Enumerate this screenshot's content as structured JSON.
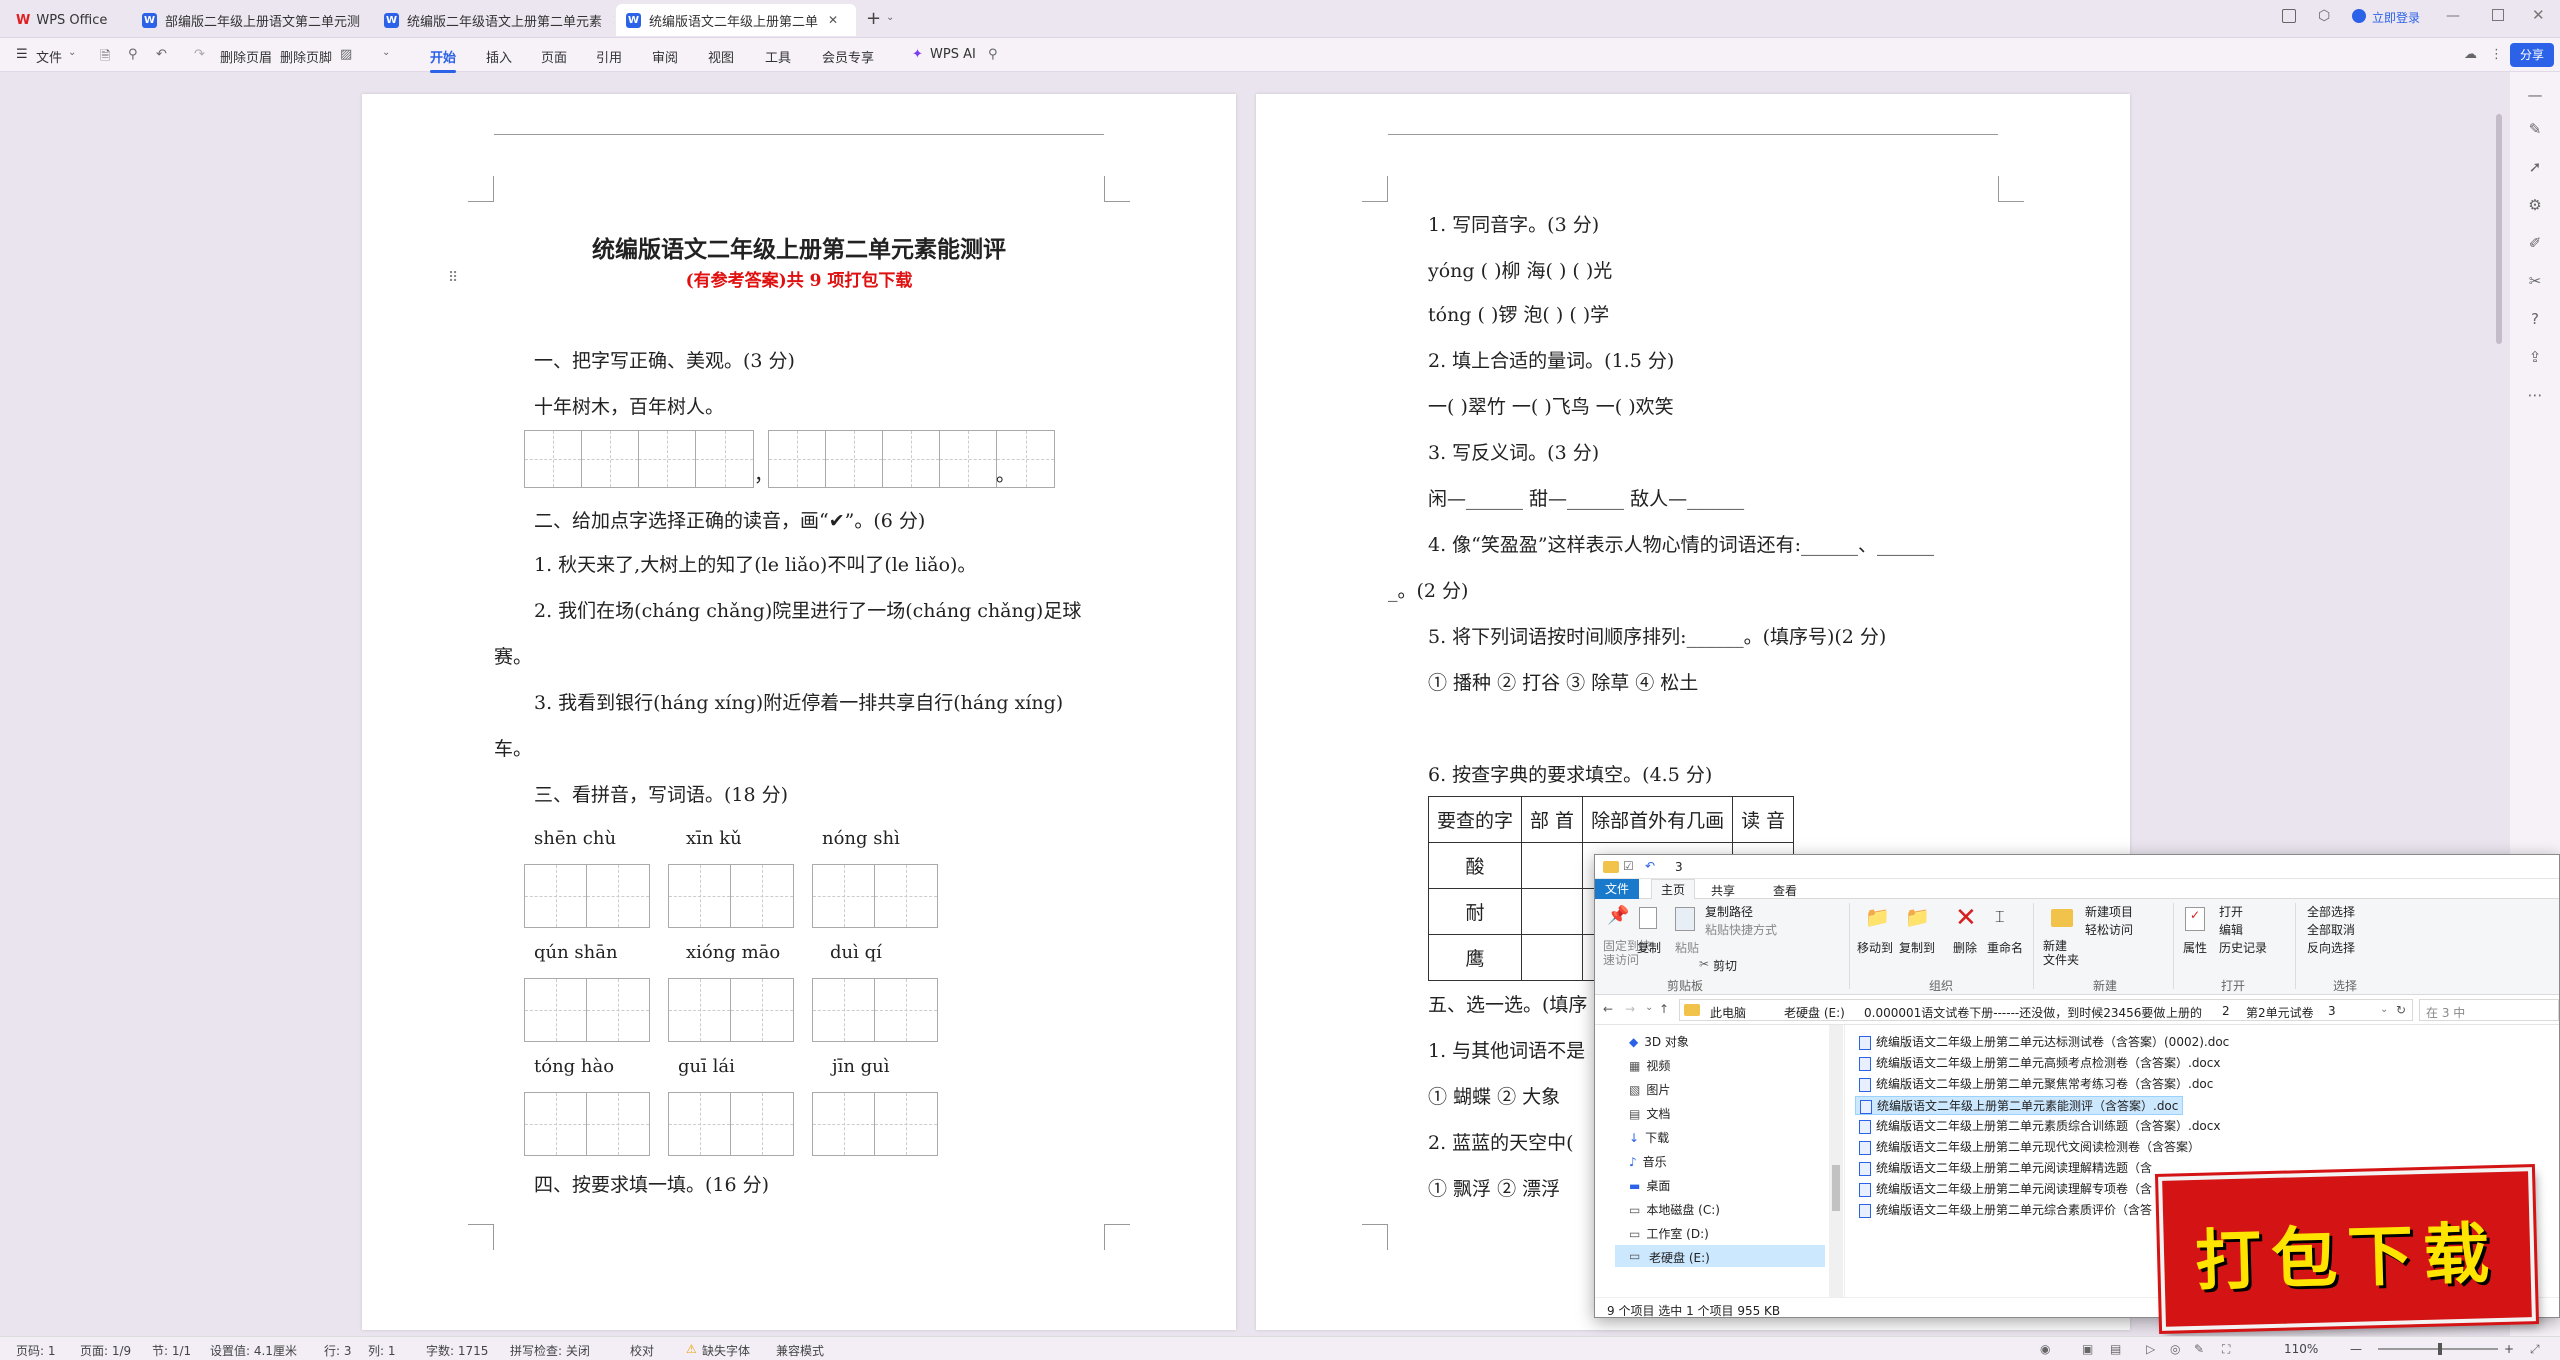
{
  "tabs": [
    {
      "label": "WPS Office"
    },
    {
      "label": "部编版二年级上册语文第二单元测"
    },
    {
      "label": "统编版二年级语文上册第二单元素"
    },
    {
      "label": "统编版语文二年级上册第二单"
    }
  ],
  "topbar": {
    "login": "立即登录",
    "plus": "+"
  },
  "toolbar": {
    "file": "文件",
    "delete_header": "删除页眉",
    "delete_footer": "删除页脚",
    "tabs": [
      "开始",
      "插入",
      "页面",
      "引用",
      "审阅",
      "视图",
      "工具",
      "会员专享"
    ],
    "wps_ai": "WPS AI",
    "share": "分享"
  },
  "page1": {
    "title": "统编版语文二年级上册第二单元素能测评",
    "subtitle": "(有参考答案)共 9 项打包下载",
    "q1": "一、把字写正确、美观。(3 分)",
    "q1_text": "十年树木，百年树人。",
    "comma": "，",
    "period": "。",
    "q2": "二、给加点字选择正确的读音，画“✔”。(6 分)",
    "q2_1": "1. 秋天来了,大树上的知了(le liǎo)不叫了(le  liǎo)。",
    "q2_2a": "2. 我们在场(cháng chǎng)院里进行了一场(cháng chǎng)足球",
    "q2_2b": "赛。",
    "q2_3a": "3. 我看到银行(háng xíng)附近停着一排共享自行(háng xíng)",
    "q2_3b": "车。",
    "q3": "三、看拼音，写词语。(18 分)",
    "pinyin": [
      [
        "shēn chù",
        "xīn  kǔ",
        "nóng  shì"
      ],
      [
        "qún shān",
        "xióng māo",
        "duì  qí"
      ],
      [
        "tóng  hào",
        "guī  lái",
        "jīn  guì"
      ]
    ],
    "q4": "四、按要求填一填。(16 分)"
  },
  "page2": {
    "p1": "1. 写同音字。(3 分)",
    "p1a": "yóng (       )柳   海(        )  (        )光",
    "p1b": "tóng (       )锣   泡(        )  (        )学",
    "p2": "2. 填上合适的量词。(1.5 分)",
    "p2a": "一(        )翠竹  一(        )飞鸟  一(        )欢笑",
    "p3": "3. 写反义词。(3 分)",
    "p3a": "闲—______   甜—______   敌人—______",
    "p4": "4. 像“笑盈盈”这样表示人物心情的词语还有:______、______",
    "p4b": "_。(2 分)",
    "p5": "5. 将下列词语按时间顺序排列:______。(填序号)(2 分)",
    "p5a": "① 播种 ② 打谷  ③ 除草 ④ 松土",
    "p6": "6. 按查字典的要求填空。(4.5 分)",
    "table_head": [
      "要查的字",
      "部 首",
      "除部首外有几画",
      "读 音"
    ],
    "table_rows": [
      "酸",
      "耐",
      "鹰"
    ],
    "s5": "五、选一选。(填序",
    "s5_1": "1. 与其他词语不是",
    "s5_1a": "① 蝴蝶  ② 大象",
    "s5_2": "2. 蓝蓝的天空中(",
    "s5_2a": "① 飘浮  ② 漂浮"
  },
  "explorer": {
    "title": "3",
    "menu": [
      "文件",
      "主页",
      "共享",
      "查看"
    ],
    "ribbon": {
      "pin": "固定到快\n速访问",
      "copy": "复制",
      "paste": "粘贴",
      "copy_path": "复制路径",
      "paste_shortcut": "粘贴快捷方式",
      "cut": "剪切",
      "clipboard": "剪贴板",
      "move_to": "移动到",
      "copy_to": "复制到",
      "delete": "删除",
      "rename": "重命名",
      "organize": "组织",
      "new_folder": "新建\n文件夹",
      "new_item": "新建项目",
      "easy_access": "轻松访问",
      "new": "新建",
      "properties": "属性",
      "open": "打开",
      "edit": "编辑",
      "history": "历史记录",
      "open_group": "打开",
      "select_all": "全部选择",
      "select_none": "全部取消",
      "invert": "反向选择",
      "select": "选择"
    },
    "path": [
      "此电脑",
      "老硬盘 (E:)",
      "0.000001语文试卷下册------还没做，到时候23456要做",
      "上册的",
      "2",
      "第2单元试卷",
      "3"
    ],
    "search": "在 3 中",
    "nav": [
      "3D 对象",
      "视频",
      "图片",
      "文档",
      "下载",
      "音乐",
      "桌面",
      "本地磁盘 (C:)",
      "工作室 (D:)",
      "老硬盘 (E:)"
    ],
    "files": [
      "统编版语文二年级上册第二单元达标测试卷（含答案）(0002).doc",
      "统编版语文二年级上册第二单元高频考点检测卷（含答案）.docx",
      "统编版语文二年级上册第二单元聚焦常考练习卷（含答案）.doc",
      "统编版语文二年级上册第二单元素能测评（含答案）.doc",
      "统编版语文二年级上册第二单元素质综合训练题（含答案）.docx",
      "统编版语文二年级上册第二单元现代文阅读检测卷（含答案）",
      "统编版语文二年级上册第二单元阅读理解精选题（含",
      "统编版语文二年级上册第二单元阅读理解专项卷（含",
      "统编版语文二年级上册第二单元综合素质评价（含答"
    ],
    "selected_index": 3,
    "status": "9 个项目    选中 1 个项目  955 KB"
  },
  "promo": "打包下载",
  "statusbar": {
    "page": "页码: 1",
    "pages": "页面: 1/9",
    "section": "节: 1/1",
    "setting": "设置值: 4.1厘米",
    "row": "行: 3",
    "col": "列: 1",
    "words": "字数: 1715",
    "spell": "拼写检查: 关闭",
    "proof": "校对",
    "missing_font": "缺失字体",
    "compat": "兼容模式",
    "zoom": "110%"
  }
}
